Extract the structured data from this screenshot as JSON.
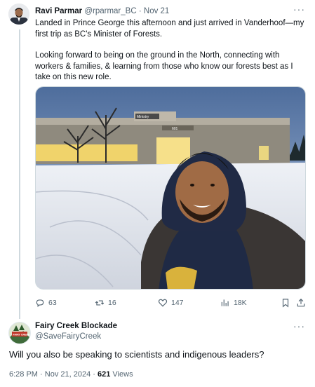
{
  "original_tweet": {
    "author_name": "Ravi Parmar",
    "handle": "@rparmar_BC",
    "separator": "·",
    "date": "Nov 21",
    "paragraph1": "Landed in Prince George this afternoon and just arrived in Vanderhoof—my first trip as BC's Minister of Forests.",
    "paragraph2": "Looking forward to being on the ground in the North, connecting with workers & families, & learning from those who know our forests best as I take on this new role.",
    "more_glyph": "···",
    "building_sign": "Ministry",
    "building_number": "601"
  },
  "actions": {
    "replies": "63",
    "reposts": "16",
    "likes": "147",
    "views": "18K"
  },
  "reply": {
    "author_name": "Fairy Creek Blockade",
    "handle": "@SaveFairyCreek",
    "more_glyph": "···",
    "text": "Will you also be speaking to scientists and indigenous leaders?",
    "avatar_text": "FAIRY CREEK"
  },
  "meta": {
    "time": "6:28 PM",
    "separator": "·",
    "date": "Nov 21, 2024",
    "views_count": "621",
    "views_label": "Views"
  },
  "colors": {
    "text": "#0f1419",
    "secondary": "#536471",
    "thread_line": "#cfd9de"
  }
}
